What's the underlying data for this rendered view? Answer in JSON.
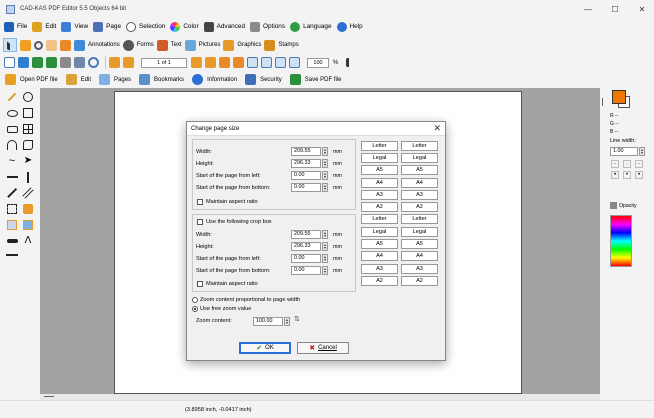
{
  "window": {
    "title": "CAD-KAS PDF Editor 5.5 Objects 64 bit",
    "minimize": "—",
    "maximize": "☐",
    "close": "✕"
  },
  "menu": {
    "items": [
      {
        "label": "File",
        "color": "#1f5fb5"
      },
      {
        "label": "Edit",
        "color": "#e0a21b"
      },
      {
        "label": "View",
        "color": "#3b7dd8"
      },
      {
        "label": "Page",
        "color": "#4b70b5"
      },
      {
        "label": "Selection",
        "color": "#5a5a5a"
      },
      {
        "label": "Color",
        "color": "#c64fd0"
      },
      {
        "label": "Advanced",
        "color": "#444444"
      },
      {
        "label": "Options",
        "color": "#6b6b6b"
      },
      {
        "label": "Language",
        "color": "#2e9d43"
      },
      {
        "label": "Help",
        "color": "#2c6ed5"
      }
    ]
  },
  "toolbar1": {
    "annotations": "Annotations",
    "forms": "Forms",
    "text": "Text",
    "pictures": "Pictures",
    "graphics": "Graphics",
    "stamps": "Stamps"
  },
  "toolbar2": {
    "page_indicator": "1 of 1",
    "zoom": "100",
    "zoom_unit": "%"
  },
  "toolbar3": {
    "open_pdf": "Open PDF file",
    "edit": "Edit",
    "pages": "Pages",
    "bookmarks": "Bookmarks",
    "information": "Information",
    "security": "Security",
    "save_pdf": "Save PDF file"
  },
  "right_panel": {
    "fill_color": "#f07800",
    "r_label": "R --",
    "g_label": "G --",
    "b_label": "B --",
    "line_width_label": "Line width:",
    "line_width_value": "1.00",
    "opacity_label": "Opacity"
  },
  "status": {
    "coords": "(3.8958 inch, -0.0417 inch)"
  },
  "dialog": {
    "title": "Change page size",
    "close": "✕",
    "width_label": "Width:",
    "width_value": "209.55",
    "height_label": "Height:",
    "height_value": "296.33",
    "start_left_label": "Start of the page from left:",
    "start_left_value": "0.00",
    "start_bottom_label": "Start of the page from bottom:",
    "start_bottom_value": "0.00",
    "unit": "mm",
    "maintain_aspect": "Maintain aspect ratio",
    "use_crop_box": "Use the following crop box",
    "crop_width_label": "Width:",
    "crop_width_value": "209.55",
    "crop_height_label": "Height:",
    "crop_height_value": "296.33",
    "crop_left_label": "Start of the page from left:",
    "crop_left_value": "0.00",
    "crop_bottom_label": "Start of the page from bottom:",
    "crop_bottom_value": "0.00",
    "crop_maintain_aspect": "Maintain aspect ratio",
    "zoom_proportional": "Zoom content proportional to page width",
    "use_free_zoom": "Use free zoom value",
    "zoom_content_label": "Zoom content:",
    "zoom_content_value": "100.00",
    "ok": "OK",
    "cancel": "Cancel",
    "preset_col1": [
      "Letter",
      "Legal",
      "A5",
      "A4",
      "A3",
      "A2"
    ],
    "preset_col2": [
      "Letter",
      "Legal",
      "A5",
      "A4",
      "A3",
      "A2"
    ],
    "crop_col1": [
      "Letter",
      "Legal",
      "A5",
      "A4",
      "A3",
      "A2"
    ],
    "crop_col2": [
      "Letter",
      "Legal",
      "A5",
      "A4",
      "A3",
      "A2"
    ]
  }
}
